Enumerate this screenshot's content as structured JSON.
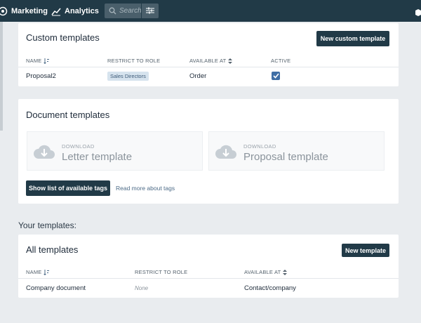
{
  "topbar": {
    "marketing": "Marketing",
    "analytics": "Analytics",
    "search_placeholder": "Search"
  },
  "custom_templates": {
    "title": "Custom templates",
    "new_button": "New custom template",
    "columns": {
      "name": "NAME",
      "role": "RESTRICT TO ROLE",
      "available": "AVAILABLE AT",
      "active": "ACTIVE"
    },
    "rows": [
      {
        "name": "Proposal2",
        "role": "Sales Directors",
        "available": "Order",
        "active": true
      }
    ]
  },
  "document_templates": {
    "title": "Document templates",
    "tiles": [
      {
        "small": "DOWNLOAD",
        "label": "Letter template"
      },
      {
        "small": "DOWNLOAD",
        "label": "Proposal template"
      }
    ],
    "tags_button": "Show list of available tags",
    "tags_link": "Read more about tags"
  },
  "your_templates_label": "Your templates:",
  "all_templates": {
    "title": "All templates",
    "new_button": "New template",
    "columns": {
      "name": "NAME",
      "role": "RESTRICT TO ROLE",
      "available": "AVAILABLE AT"
    },
    "rows": [
      {
        "name": "Company document",
        "role": "None",
        "available": "Contact/company"
      }
    ]
  },
  "colors": {
    "topbar": "#213a47",
    "button": "#213a47",
    "accent": "#3f6ea5",
    "badge_bg": "#d6e3ee"
  }
}
